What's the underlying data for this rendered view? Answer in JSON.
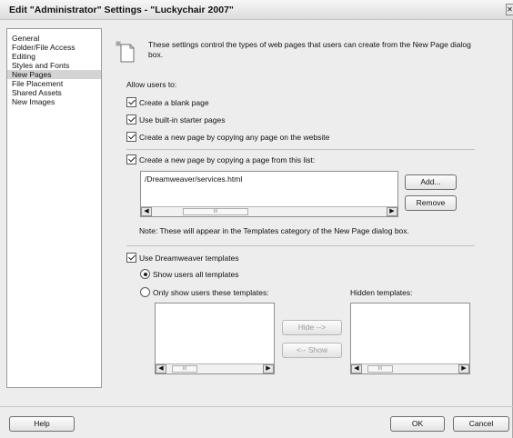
{
  "window": {
    "title": "Edit \"Administrator\" Settings - \"Luckychair 2007\"",
    "close_glyph": "✕"
  },
  "sidebar": {
    "items": [
      {
        "label": "General"
      },
      {
        "label": "Folder/File Access"
      },
      {
        "label": "Editing"
      },
      {
        "label": "Styles and Fonts"
      },
      {
        "label": "New Pages",
        "selected": true
      },
      {
        "label": "File Placement"
      },
      {
        "label": "Shared Assets"
      },
      {
        "label": "New Images"
      }
    ]
  },
  "content": {
    "info_text": "These settings control the types of web pages that users can create from the New Page dialog box.",
    "allow_label": "Allow users to:",
    "options": {
      "blank_page": {
        "label": "Create a blank page",
        "checked": true
      },
      "starter_pages": {
        "label": "Use built-in starter pages",
        "checked": true
      },
      "copy_any": {
        "label": "Create a new page by copying any page on the website",
        "checked": true
      },
      "copy_from_list": {
        "label": "Create a new page by copying a page from this list:",
        "checked": true
      },
      "use_templates": {
        "label": "Use Dreamweaver templates",
        "checked": true
      }
    },
    "page_list": {
      "items": [
        "/Dreamweaver/services.html"
      ]
    },
    "add_label": "Add...",
    "remove_label": "Remove",
    "note": "Note: These will appear in the Templates category of the New Page dialog box.",
    "template_options": {
      "show_all": {
        "label": "Show users all templates",
        "selected": true
      },
      "only_these": {
        "label": "Only show users these templates:",
        "selected": false
      }
    },
    "hidden_templates_label": "Hidden templates:",
    "hide_label": "Hide -->",
    "show_label": "<-- Show",
    "scroll_thumb": "III",
    "scroll_left": "◀",
    "scroll_right": "▶"
  },
  "footer": {
    "help_label": "Help",
    "ok_label": "OK",
    "cancel_label": "Cancel"
  }
}
